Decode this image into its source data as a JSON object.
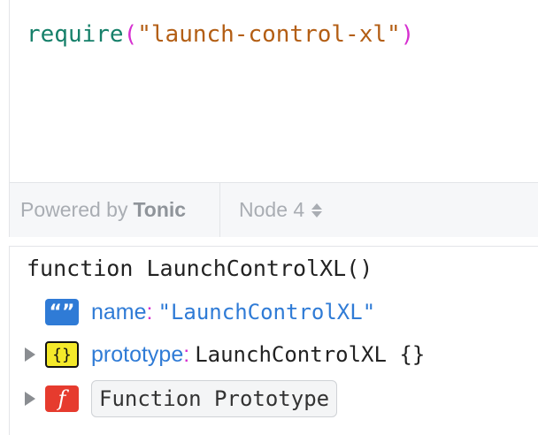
{
  "editor": {
    "code": {
      "fn_name": "require",
      "open_paren": "(",
      "argument": "\"launch-control-xl\"",
      "close_paren": ")"
    },
    "footer": {
      "powered_by_label": "Powered by",
      "brand": "Tonic",
      "runtime_label": "Node 4"
    }
  },
  "result": {
    "title": "function LaunchControlXL()",
    "properties": [
      {
        "badge": "“”",
        "badge_icon": "string-type-icon",
        "key": "name",
        "colon": ":",
        "value": "\"LaunchControlXL\"",
        "expandable": false
      },
      {
        "badge": "{}",
        "badge_icon": "object-type-icon",
        "key": "prototype",
        "colon": ":",
        "value": "LaunchControlXL {}",
        "expandable": true
      }
    ],
    "function_prototype": {
      "badge": "f",
      "badge_icon": "function-type-icon",
      "label": "Function Prototype",
      "expandable": true
    }
  },
  "colors": {
    "string_key": "#2f7bd6",
    "punctuation": "#d62fd0",
    "code_fn": "#16806a",
    "code_string": "#b35e14",
    "badge_string": "#2f7bd6",
    "badge_object": "#f4e92a",
    "badge_function": "#e63b2e"
  }
}
